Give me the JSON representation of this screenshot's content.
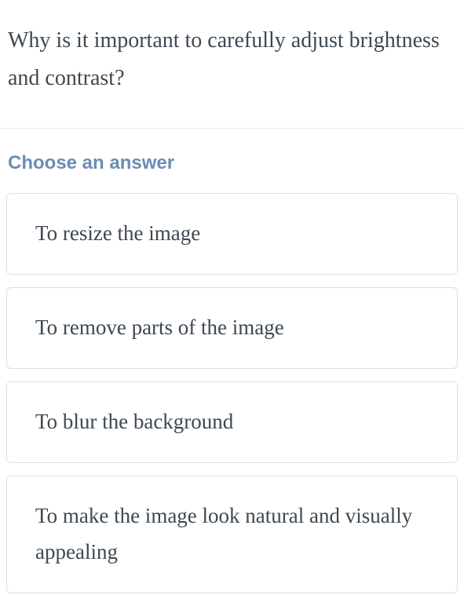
{
  "question": {
    "text": "Why is it important to carefully adjust brightness and contrast?"
  },
  "answer": {
    "heading": "Choose an answer",
    "options": [
      {
        "label": "To resize the image"
      },
      {
        "label": "To remove parts of the image"
      },
      {
        "label": "To blur the background"
      },
      {
        "label": "To make the image look natural and visually appealing"
      }
    ]
  }
}
